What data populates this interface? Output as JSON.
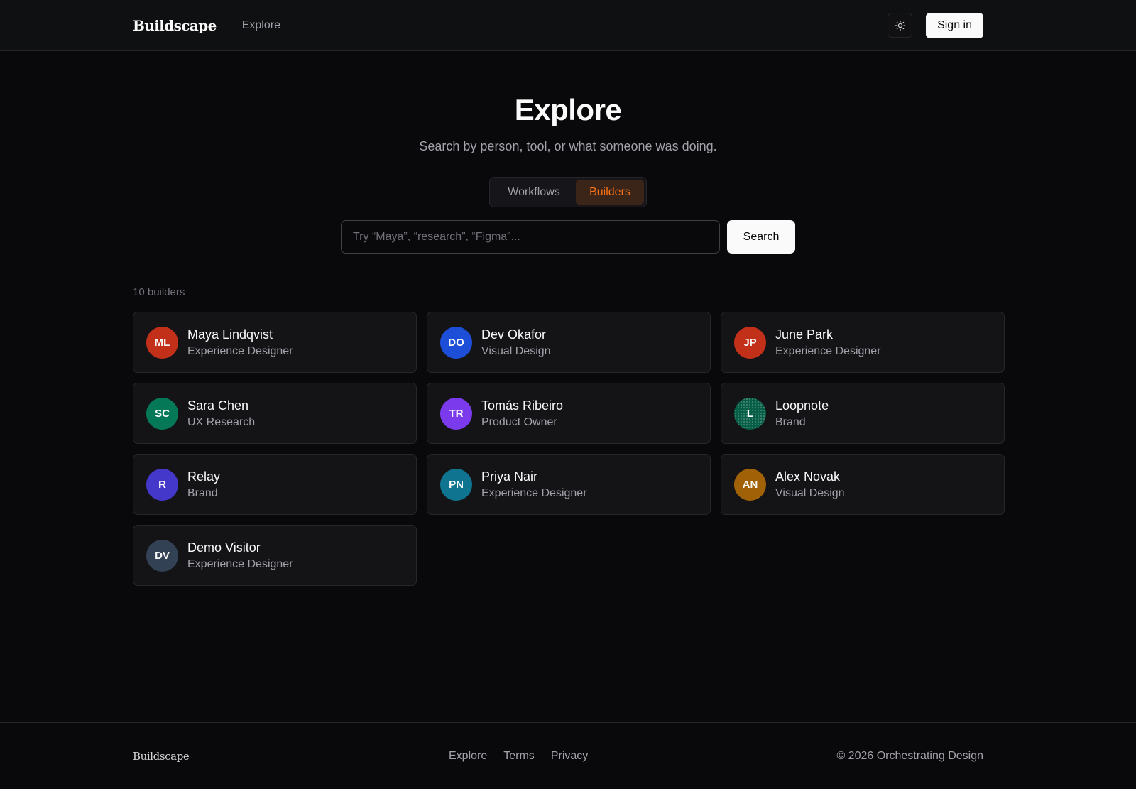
{
  "header": {
    "brand": "Buildscape",
    "nav_explore": "Explore",
    "theme_icon": "sun-icon",
    "sign_in": "Sign in"
  },
  "hero": {
    "title": "Explore",
    "subtitle": "Search by person, tool, or what someone was doing."
  },
  "toggle": {
    "options": [
      "Workflows",
      "Builders"
    ],
    "active": "Builders"
  },
  "search": {
    "placeholder": "Try “Maya”, “research”, “Figma”...",
    "button": "Search"
  },
  "results": {
    "count_label": "10 builders",
    "builders": [
      {
        "initials": "ML",
        "name": "Maya Lindqvist",
        "role": "Experience Designer",
        "color": "#c2301a"
      },
      {
        "initials": "DO",
        "name": "Dev Okafor",
        "role": "Visual Design",
        "color": "#1d4ed8"
      },
      {
        "initials": "JP",
        "name": "June Park",
        "role": "Experience Designer",
        "color": "#c2301a"
      },
      {
        "initials": "SC",
        "name": "Sara Chen",
        "role": "UX Research",
        "color": "#047857"
      },
      {
        "initials": "TR",
        "name": "Tomás Ribeiro",
        "role": "Product Owner",
        "color": "#7c3aed"
      },
      {
        "initials": "L",
        "name": "Loopnote",
        "role": "Brand",
        "color": "#065f46"
      },
      {
        "initials": "R",
        "name": "Relay",
        "role": "Brand",
        "color": "#4338ca"
      },
      {
        "initials": "PN",
        "name": "Priya Nair",
        "role": "Experience Designer",
        "color": "#0e7490"
      },
      {
        "initials": "AN",
        "name": "Alex Novak",
        "role": "Visual Design",
        "color": "#a16207"
      },
      {
        "initials": "DV",
        "name": "Demo Visitor",
        "role": "Experience Designer",
        "color": "#334155"
      }
    ]
  },
  "footer": {
    "brand": "Buildscape",
    "links": [
      "Explore",
      "Terms",
      "Privacy"
    ],
    "copyright": "© 2026 Orchestrating Design"
  }
}
